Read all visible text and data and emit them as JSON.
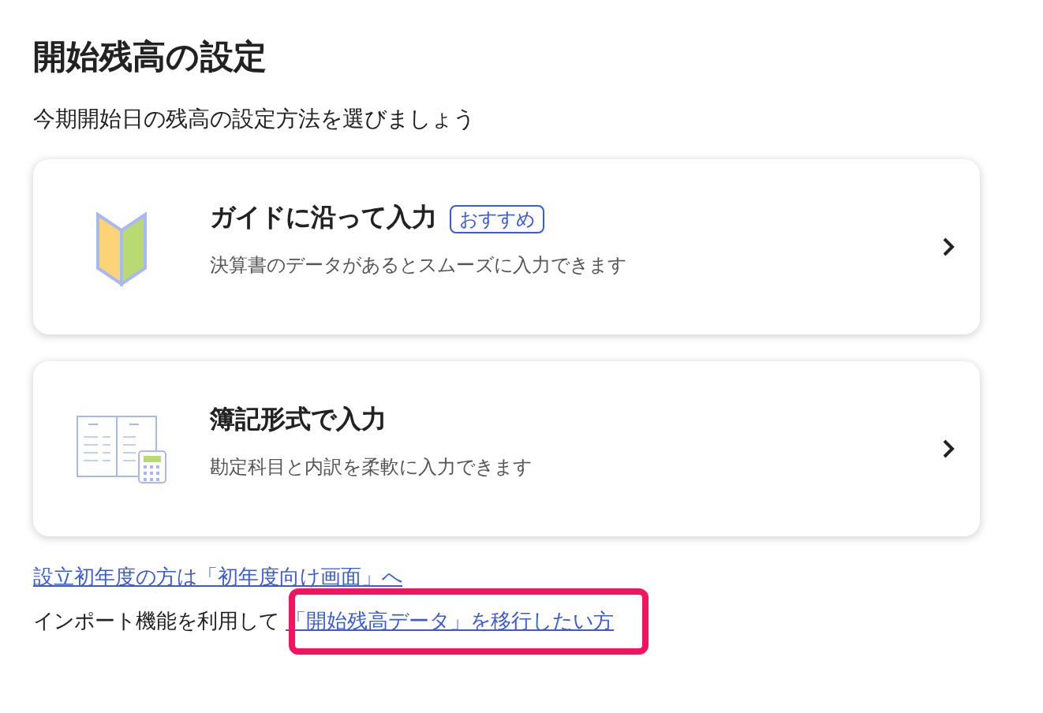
{
  "title": "開始残高の設定",
  "subtitle": "今期開始日の残高の設定方法を選びましょう",
  "options": [
    {
      "kind": "guide",
      "title": "ガイドに沿って入力",
      "badge": "おすすめ",
      "description": "決算書のデータがあるとスムーズに入力できます"
    },
    {
      "kind": "bookkeeping",
      "title": "簿記形式で入力",
      "description": "勘定科目と内訳を柔軟に入力できます"
    }
  ],
  "first_year_link": "設立初年度の方は「初年度向け画面」へ",
  "import_line": {
    "prefix": "インポート機能を利用して",
    "link": "「開始残高データ」を移行したい方",
    "highlighted": true
  }
}
